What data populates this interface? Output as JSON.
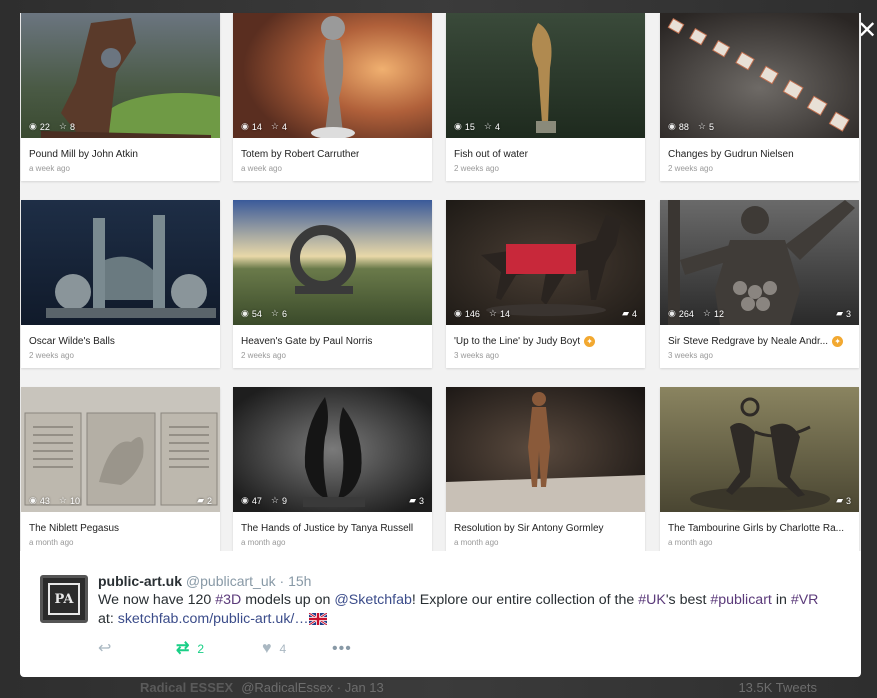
{
  "gallery": {
    "cards": [
      {
        "title": "Pound Mill by John Atkin",
        "time": "a week ago",
        "views": "22",
        "likes": "8",
        "comments": "",
        "staff_pick": false
      },
      {
        "title": "Totem by Robert Carruther",
        "time": "a week ago",
        "views": "14",
        "likes": "4",
        "comments": "",
        "staff_pick": false
      },
      {
        "title": "Fish out of water",
        "time": "2 weeks ago",
        "views": "15",
        "likes": "4",
        "comments": "",
        "staff_pick": false
      },
      {
        "title": "Changes by Gudrun Nielsen",
        "time": "2 weeks ago",
        "views": "88",
        "likes": "5",
        "comments": "",
        "staff_pick": false
      },
      {
        "title": "Oscar Wilde's Balls",
        "time": "2 weeks ago",
        "views": "",
        "likes": "",
        "comments": "",
        "staff_pick": false
      },
      {
        "title": "Heaven's Gate by Paul Norris",
        "time": "2 weeks ago",
        "views": "54",
        "likes": "6",
        "comments": "",
        "staff_pick": false
      },
      {
        "title": "'Up to the Line' by Judy Boyt",
        "time": "3 weeks ago",
        "views": "146",
        "likes": "14",
        "comments": "4",
        "staff_pick": true
      },
      {
        "title": "Sir Steve Redgrave by Neale Andr...",
        "time": "3 weeks ago",
        "views": "264",
        "likes": "12",
        "comments": "3",
        "staff_pick": true
      },
      {
        "title": "The Niblett Pegasus",
        "time": "a month ago",
        "views": "43",
        "likes": "10",
        "comments": "2",
        "staff_pick": false
      },
      {
        "title": "The Hands of Justice by Tanya Russell",
        "time": "a month ago",
        "views": "47",
        "likes": "9",
        "comments": "3",
        "staff_pick": false
      },
      {
        "title": "Resolution by Sir Antony Gormley",
        "time": "a month ago",
        "views": "",
        "likes": "",
        "comments": "",
        "staff_pick": false
      },
      {
        "title": "The Tambourine Girls by Charlotte Ra...",
        "time": "a month ago",
        "views": "",
        "likes": "",
        "comments": "3",
        "staff_pick": false
      }
    ]
  },
  "tweet": {
    "avatar_text": "PA",
    "display_name": "public-art.uk",
    "handle": "@publicart_uk",
    "separator": "·",
    "time": "15h",
    "text_1": "We now have 120 ",
    "tag_3d": "#3D",
    "text_2": " models up on ",
    "mention": "@Sketchfab",
    "text_3": "! Explore our entire collection of the ",
    "tag_uk": "#UK",
    "text_4": "'s best ",
    "tag_publicart": "#publicart",
    "text_5": " in ",
    "tag_vr": "#VR",
    "text_6": "at: ",
    "link": "sketchfab.com/public-art.uk/…",
    "retweets": "2",
    "likes": "4"
  },
  "background": {
    "bottom_name": "Radical ESSEX",
    "bottom_handle": "@RadicalEssex · Jan 13",
    "bottom_right": "13.5K Tweets"
  },
  "colors": {
    "retweet_green": "#19cf86",
    "link_blue": "#3b4c8a",
    "staff_pick_orange": "#f2a830"
  }
}
